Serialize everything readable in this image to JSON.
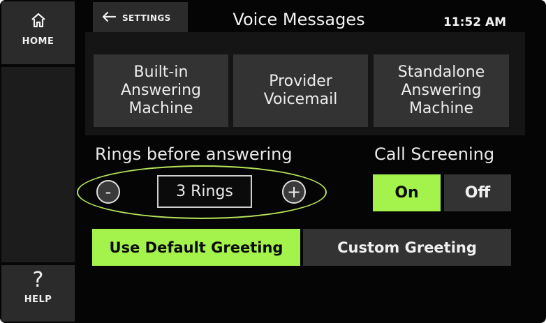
{
  "sidebar": {
    "home_label": "HOME",
    "help_label": "HELP",
    "help_glyph": "?",
    "home_icon": "home-icon"
  },
  "header": {
    "back_label": "SETTINGS",
    "back_icon": "arrow-left-icon",
    "title": "Voice Messages",
    "time": "11:52 AM"
  },
  "modes": [
    {
      "lines": [
        "Built-in",
        "Answering",
        "Machine"
      ]
    },
    {
      "lines": [
        "Provider",
        "Voicemail"
      ]
    },
    {
      "lines": [
        "Standalone",
        "Answering",
        "Machine"
      ]
    }
  ],
  "rings": {
    "label": "Rings before answering",
    "value": "3 Rings",
    "decrement": "-",
    "increment": "+"
  },
  "call_screening": {
    "label": "Call Screening",
    "on_label": "On",
    "off_label": "Off",
    "selected": "On"
  },
  "greetings": {
    "default_label": "Use Default Greeting",
    "custom_label": "Custom Greeting",
    "selected": "Use Default Greeting"
  },
  "colors": {
    "accent": "#a4f34d",
    "highlight_outline": "#b6e35b",
    "button_bg": "#333333",
    "background": "#050505"
  }
}
